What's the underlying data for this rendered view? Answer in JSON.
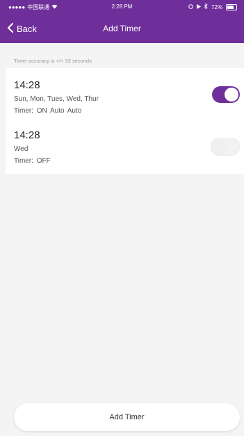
{
  "status_bar": {
    "carrier": "中国联通",
    "time": "2:28 PM",
    "battery": "72%"
  },
  "nav": {
    "back_label": "Back",
    "title": "Add Timer"
  },
  "accuracy_note": "Timer accuracy is +/+ 33 seconds",
  "timers": [
    {
      "time": "14:28",
      "days": "Sun, Mon, Tues, Wed, Thur",
      "status": "Timer: ON   Auto   Auto",
      "enabled": true
    },
    {
      "time": "14:28",
      "days": "Wed",
      "status": "Timer: OFF",
      "enabled": false
    }
  ],
  "add_button_label": "Add Timer",
  "colors": {
    "accent": "#6f2f9a",
    "background": "#f4f4f4"
  }
}
